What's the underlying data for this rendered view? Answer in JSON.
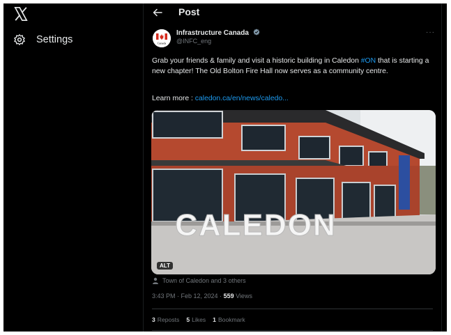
{
  "nav": {
    "logo_icon": "x-logo-icon",
    "settings_label": "Settings",
    "settings_icon": "gear-icon"
  },
  "header": {
    "back_icon": "arrow-left-icon",
    "title": "Post"
  },
  "post": {
    "author": {
      "name": "Infrastructure Canada",
      "handle": "@INFC_eng",
      "avatar_text": "Canada",
      "verified_icon": "verified-badge-icon"
    },
    "more_label": "···",
    "text_part1": "Grab your friends & family and visit a historic building in Caledon ",
    "hashtag": "#ON",
    "text_part2": " that is starting a new chapter! The Old Bolton Fire Hall now serves as a community centre.",
    "learn_label": "Learn more : ",
    "learn_link": "caledon.ca/en/news/caledo...",
    "media": {
      "sign_text": "CALEDON",
      "alt_badge": "ALT"
    },
    "tagged": "Town of Caledon and 3 others",
    "time": "3:43 PM · Feb 12, 2024 · ",
    "views_count": "559",
    "views_label": " Views",
    "stats": [
      {
        "count": "3",
        "label": "Reposts"
      },
      {
        "count": "5",
        "label": "Likes"
      },
      {
        "count": "1",
        "label": "Bookmark"
      }
    ]
  },
  "colors": {
    "background": "#000000",
    "text": "#e7e9ea",
    "muted": "#71767b",
    "accent": "#1d9bf0",
    "brick": "#b5492f"
  }
}
